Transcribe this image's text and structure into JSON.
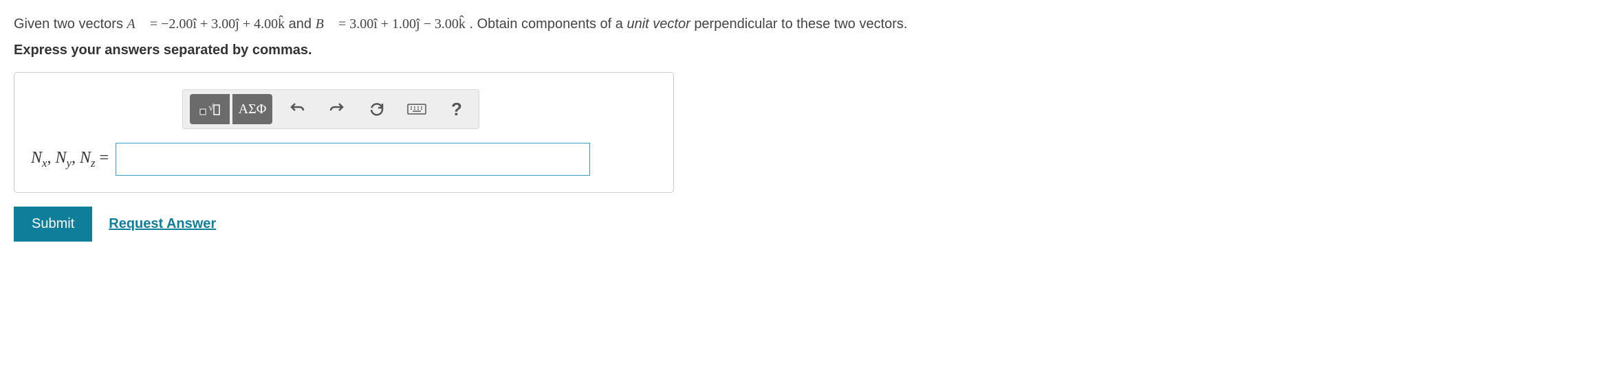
{
  "question": {
    "prefix": "Given two vectors ",
    "vectorA_symbol": "A⃗",
    "equals1": " = ",
    "vectorA_value": "−2.00î + 3.00ĵ + 4.00k̂",
    "and_text": " and ",
    "vectorB_symbol": "B⃗",
    "equals2": " = ",
    "vectorB_value": "3.00î + 1.00ĵ − 3.00k̂",
    "suffix": ". Obtain components of a ",
    "unit_vector": "unit vector",
    "suffix2": " perpendicular to these two vectors."
  },
  "instruction": "Express your answers separated by commas.",
  "toolbar": {
    "greek_label": "ΑΣΦ",
    "help_label": "?"
  },
  "answer": {
    "label_Nx": "N",
    "sub_x": "x",
    "label_Ny": "N",
    "sub_y": "y",
    "label_Nz": "N",
    "sub_z": "z",
    "comma": ", ",
    "equals": " = ",
    "value": ""
  },
  "buttons": {
    "submit": "Submit",
    "request": "Request Answer"
  }
}
